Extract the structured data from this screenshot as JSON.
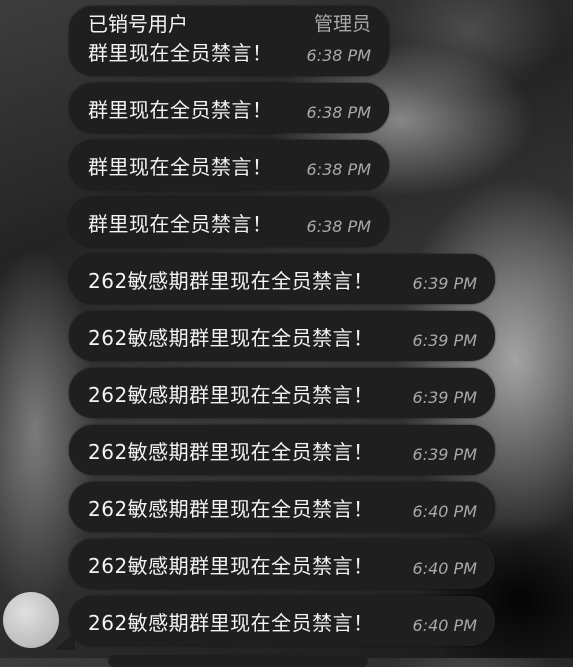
{
  "conversation": {
    "first": {
      "sender_name": "已销号用户",
      "sender_role": "管理员",
      "text": "群里现在全员禁言！",
      "time": "6:38 PM"
    },
    "short_messages": [
      {
        "text": "群里现在全员禁言！",
        "time": "6:38 PM"
      },
      {
        "text": "群里现在全员禁言！",
        "time": "6:38 PM"
      },
      {
        "text": "群里现在全员禁言！",
        "time": "6:38 PM"
      }
    ],
    "long_messages": [
      {
        "text": "262敏感期群里现在全员禁言！",
        "time": "6:39 PM"
      },
      {
        "text": "262敏感期群里现在全员禁言！",
        "time": "6:39 PM"
      },
      {
        "text": "262敏感期群里现在全员禁言！",
        "time": "6:39 PM"
      },
      {
        "text": "262敏感期群里现在全员禁言！",
        "time": "6:39 PM"
      },
      {
        "text": "262敏感期群里现在全员禁言！",
        "time": "6:40 PM"
      },
      {
        "text": "262敏感期群里现在全员禁言！",
        "time": "6:40 PM"
      },
      {
        "text": "262敏感期群里现在全员禁言！",
        "time": "6:40 PM"
      }
    ]
  },
  "colors": {
    "bubble": "#1f1f1f",
    "text": "#f4f4f4",
    "time": "#a9a9a9",
    "avatar": "#c4c4c4"
  }
}
